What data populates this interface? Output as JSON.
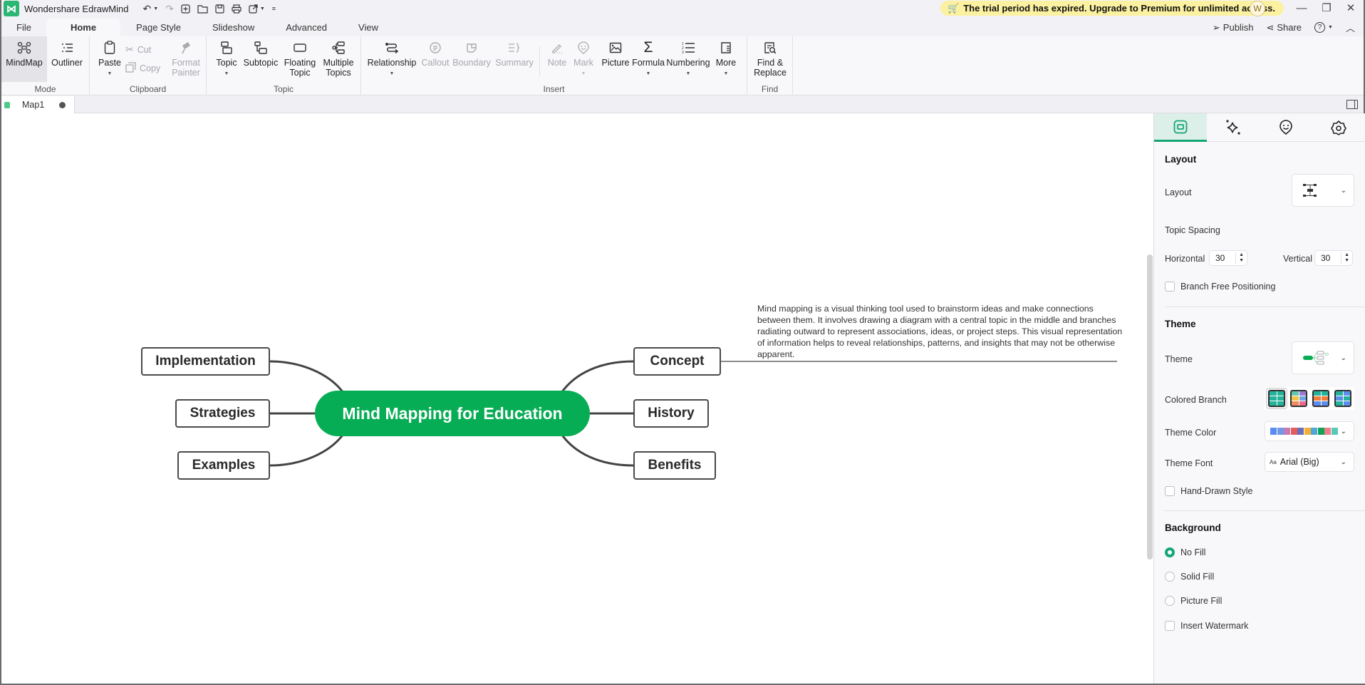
{
  "app": {
    "title": "Wondershare EdrawMind",
    "logo_glyph": "⋈",
    "trial_banner": "The trial period has expired. Upgrade to Premium for unlimited access.",
    "avatar_initial": "W",
    "quick_access": [
      "undo-icon",
      "redo-icon",
      "new-icon",
      "open-icon",
      "save-icon",
      "print-icon",
      "export-icon",
      "customize-icon"
    ]
  },
  "menu": {
    "tabs": [
      {
        "label": "File",
        "active": false
      },
      {
        "label": "Home",
        "active": true
      },
      {
        "label": "Page Style",
        "active": false
      },
      {
        "label": "Slideshow",
        "active": false
      },
      {
        "label": "Advanced",
        "active": false
      },
      {
        "label": "View",
        "active": false
      }
    ],
    "publish": "Publish",
    "share": "Share"
  },
  "ribbon": {
    "groups": {
      "mode": "Mode",
      "clipboard": "Clipboard",
      "topic": "Topic",
      "insert": "Insert",
      "find": "Find"
    },
    "mindmap": "MindMap",
    "outliner": "Outliner",
    "paste": "Paste",
    "cut": "Cut",
    "copy": "Copy",
    "format_painter_1": "Format",
    "format_painter_2": "Painter",
    "topic": "Topic",
    "subtopic": "Subtopic",
    "floating_topic_1": "Floating",
    "floating_topic_2": "Topic",
    "multiple_topics_1": "Multiple",
    "multiple_topics_2": "Topics",
    "relationship": "Relationship",
    "callout": "Callout",
    "boundary": "Boundary",
    "summary": "Summary",
    "note": "Note",
    "mark": "Mark",
    "picture": "Picture",
    "formula": "Formula",
    "numbering": "Numbering",
    "more": "More",
    "find_replace_1": "Find &",
    "find_replace_2": "Replace"
  },
  "document": {
    "tab_label": "Map1"
  },
  "mindmap": {
    "central": "Mind Mapping for Education",
    "central_color": "#07ad55",
    "left_topics": [
      "Implementation",
      "Strategies",
      "Examples"
    ],
    "right_topics": [
      "Concept",
      "History",
      "Benefits"
    ],
    "note": "Mind mapping is a visual thinking tool used to brainstorm ideas and make connections between them. It involves drawing a diagram with a central topic in the middle and branches radiating outward to represent associations, ideas, or project steps. This visual representation of information helps to reveal relationships, patterns, and insights that may not be otherwise apparent."
  },
  "panel": {
    "layout_section": "Layout",
    "layout_label": "Layout",
    "topic_spacing": "Topic Spacing",
    "horizontal_label": "Horizontal",
    "horizontal_value": "30",
    "vertical_label": "Vertical",
    "vertical_value": "30",
    "branch_free": "Branch Free Positioning",
    "theme_section": "Theme",
    "theme_label": "Theme",
    "colored_branch": "Colored Branch",
    "theme_color": "Theme Color",
    "theme_color_swatches": [
      "#5b8def",
      "#6f9ae8",
      "#c77bb5",
      "#e35d5d",
      "#6a6fb8",
      "#f2b035",
      "#4ea8d8",
      "#12a35a",
      "#ef7f8c",
      "#5ac7b8"
    ],
    "theme_font": "Theme Font",
    "theme_font_value": "Arial (Big)",
    "theme_font_glyph": "Aa",
    "hand_drawn": "Hand-Drawn Style",
    "background_section": "Background",
    "no_fill": "No Fill",
    "solid_fill": "Solid Fill",
    "picture_fill": "Picture Fill",
    "insert_watermark": "Insert Watermark",
    "accent": "#15a673"
  }
}
